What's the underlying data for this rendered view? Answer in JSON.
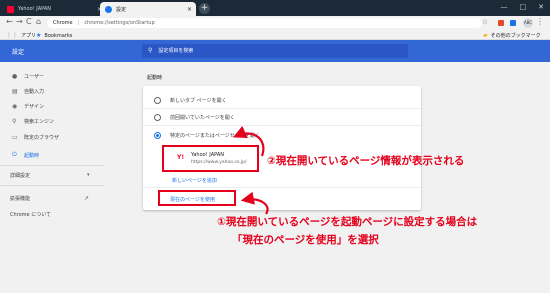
{
  "browser": {
    "tabs": [
      {
        "title": "Yahoo! JAPAN",
        "icon": "yahoo-favicon"
      },
      {
        "title": "設定",
        "icon": "gear-icon"
      }
    ],
    "close_glyph": "×",
    "new_tab_glyph": "+",
    "window_controls": [
      "—",
      "□",
      "✕"
    ],
    "back_glyph": "←",
    "forward_glyph": "→",
    "reload_glyph": "C",
    "home_glyph": "⌂",
    "address": {
      "origin": "Chrome",
      "separator": "|",
      "path": "chrome://settings/onStartup"
    },
    "star_glyph": "☆",
    "avatar_text": "ABC",
    "menu_glyph": "⋮",
    "bookmarks_bar": {
      "apps": "アプリ",
      "bookmarks": "Bookmarks",
      "other": "その他のブックマーク"
    }
  },
  "settings": {
    "title": "設定",
    "search_placeholder": "設定項目を検索",
    "sidebar": [
      {
        "label": "ユーザー",
        "icon": "person-icon"
      },
      {
        "label": "自動入力",
        "icon": "autofill-icon"
      },
      {
        "label": "デザイン",
        "icon": "palette-icon"
      },
      {
        "label": "検索エンジン",
        "icon": "search-icon"
      },
      {
        "label": "既定のブラウザ",
        "icon": "browser-icon"
      },
      {
        "label": "起動時",
        "icon": "power-icon",
        "active": true
      }
    ],
    "advanced": {
      "label": "詳細設定",
      "chevron": "▾"
    },
    "extensions": {
      "label": "拡張機能",
      "external_glyph": "↗"
    },
    "about": "Chrome について",
    "section_title": "起動時",
    "startup_options": [
      {
        "label": "新しいタブ ページを開く",
        "checked": false
      },
      {
        "label": "前回開いていたページを開く",
        "checked": false
      },
      {
        "label": "特定のページまたはページセットを開く",
        "checked": true
      }
    ],
    "page_entry": {
      "favicon_text": "Y!",
      "name": "Yahoo! JAPAN",
      "url": "https://www.yahoo.co.jp/"
    },
    "add_page_link": "新しいページを追加",
    "use_current_link": "現在のページを使用"
  },
  "annotations": {
    "note2": "②現在開いているページ情報が表示される",
    "note1_line1": "①現在開いているページを起動ページに設定する場合は",
    "note1_line2": "「現在のページを使用」を選択",
    "highlight_color": "#e5001c"
  },
  "colors": {
    "header_blue": "#3367d6",
    "accent": "#1a73e8",
    "tab_strip": "#1c2a37"
  }
}
